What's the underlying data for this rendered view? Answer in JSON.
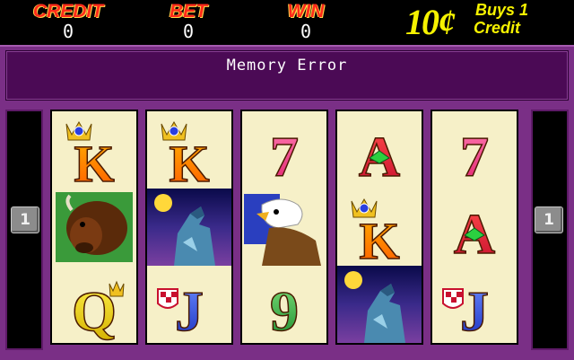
{
  "stats": {
    "credit": {
      "label": "CREDIT",
      "value": "0"
    },
    "bet": {
      "label": "BET",
      "value": "0"
    },
    "win": {
      "label": "WIN",
      "value": "0"
    }
  },
  "denomination": {
    "amount": "10¢",
    "line1": "Buys 1",
    "line2": "Credit"
  },
  "message": "Memory Error",
  "line_marker": "1",
  "colors": {
    "background": "#7a2f86",
    "message_panel": "#4b0a55",
    "label_red": "#ff2a1a",
    "denom_yellow": "#f6f200",
    "reel_bg": "#f6f0c8"
  },
  "reels": [
    {
      "symbols": [
        {
          "icon": "king-icon",
          "text": "K"
        },
        {
          "icon": "buffalo-icon",
          "text": ""
        },
        {
          "icon": "queen-icon",
          "text": "Q"
        }
      ]
    },
    {
      "symbols": [
        {
          "icon": "king-icon",
          "text": "K"
        },
        {
          "icon": "wolf-icon",
          "text": ""
        },
        {
          "icon": "jack-icon",
          "text": "J"
        }
      ]
    },
    {
      "symbols": [
        {
          "icon": "seven-icon",
          "text": "7"
        },
        {
          "icon": "eagle-icon",
          "text": ""
        },
        {
          "icon": "nine-icon",
          "text": "9"
        }
      ]
    },
    {
      "symbols": [
        {
          "icon": "ace-icon",
          "text": "A"
        },
        {
          "icon": "king-icon",
          "text": "K"
        },
        {
          "icon": "wolf-icon",
          "text": ""
        }
      ]
    },
    {
      "symbols": [
        {
          "icon": "seven-icon",
          "text": "7"
        },
        {
          "icon": "ace-icon",
          "text": "A"
        },
        {
          "icon": "jack-icon",
          "text": "J"
        }
      ]
    }
  ]
}
